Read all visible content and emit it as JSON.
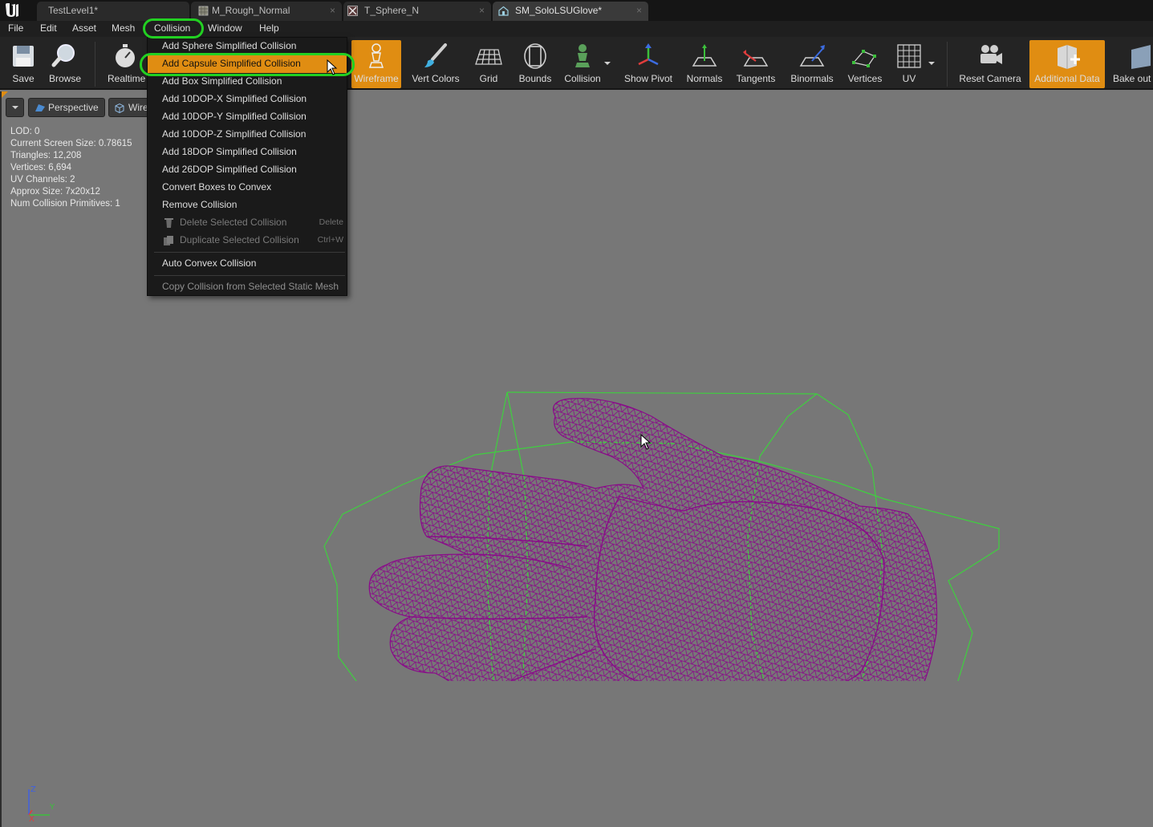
{
  "tabs": [
    {
      "label": "TestLevel1*",
      "icon": "level-icon"
    },
    {
      "label": "M_Rough_Normal",
      "icon": "material-icon",
      "close": "×"
    },
    {
      "label": "T_Sphere_N",
      "icon": "texture-icon",
      "close": "×"
    },
    {
      "label": "SM_SoloLSUGlove*",
      "icon": "static-mesh-icon",
      "close": "×"
    }
  ],
  "menubar": [
    "File",
    "Edit",
    "Asset",
    "Mesh",
    "Collision",
    "Window",
    "Help"
  ],
  "toolbar": {
    "save": "Save",
    "browse": "Browse",
    "realtime": "Realtime",
    "wireframe": "Wireframe",
    "vert_colors": "Vert Colors",
    "grid": "Grid",
    "bounds": "Bounds",
    "collision": "Collision",
    "show_pivot": "Show Pivot",
    "normals": "Normals",
    "tangents": "Tangents",
    "binormals": "Binormals",
    "vertices": "Vertices",
    "uv": "UV",
    "reset_camera": "Reset Camera",
    "additional_data": "Additional Data",
    "bake_out": "Bake out"
  },
  "viewport": {
    "perspective": "Perspective",
    "wireframe_mode": "Wire",
    "stats": [
      "LOD:  0",
      "Current Screen Size:  0.78615",
      "Triangles:  12,208",
      "Vertices:  6,694",
      "UV Channels:  2",
      "Approx Size: 7x20x12",
      "Num Collision Primitives:  1"
    ],
    "axis": {
      "z": "Z",
      "y": "Y",
      "x": "X"
    }
  },
  "collision_menu": {
    "items": [
      "Add Sphere Simplified Collision",
      "Add Capsule Simplified Collision",
      "Add Box Simplified Collision",
      "Add 10DOP-X Simplified Collision",
      "Add 10DOP-Y Simplified Collision",
      "Add 10DOP-Z Simplified Collision",
      "Add 18DOP Simplified Collision",
      "Add 26DOP Simplified Collision",
      "Convert Boxes to Convex",
      "Remove Collision"
    ],
    "delete_selected": "Delete Selected Collision",
    "delete_shortcut": "Delete",
    "duplicate_selected": "Duplicate Selected Collision",
    "duplicate_shortcut": "Ctrl+W",
    "auto_convex": "Auto Convex Collision",
    "copy_collision": "Copy Collision from Selected Static Mesh",
    "highlighted": "Add Capsule Simplified Collision"
  },
  "colors": {
    "accent": "#e08d12",
    "wireframe": "#8a0a8a",
    "collision": "#3fcf3f",
    "annotation": "#22d022"
  }
}
